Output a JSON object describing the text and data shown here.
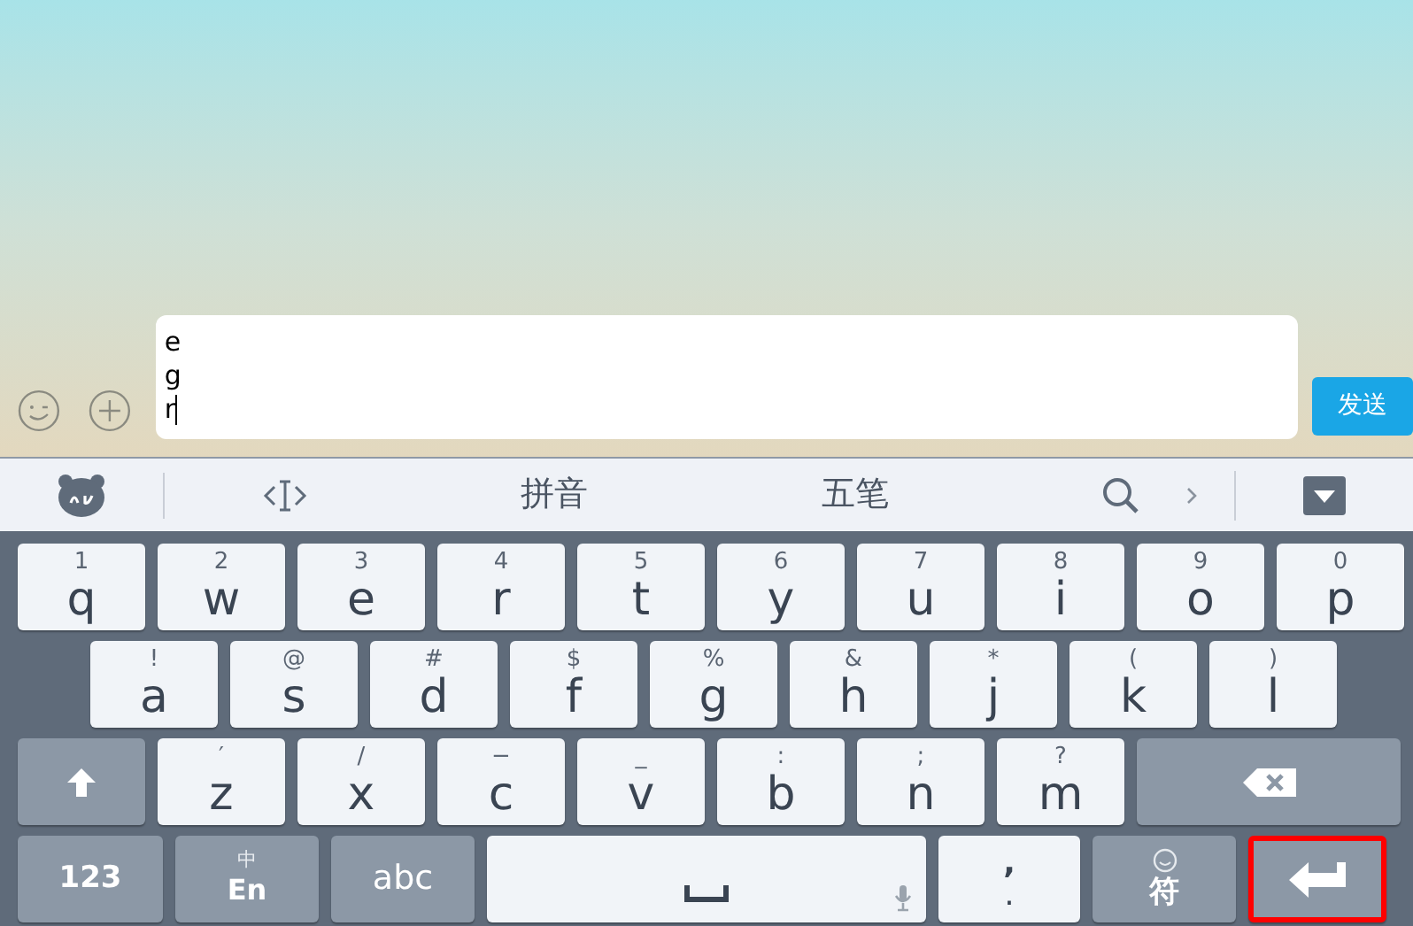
{
  "composer": {
    "lines": [
      "e",
      "g",
      "r"
    ],
    "send_button": "发送"
  },
  "toolbar": {
    "items": [
      {
        "kind": "logo"
      },
      {
        "kind": "cursor"
      },
      {
        "kind": "text",
        "label": "拼音"
      },
      {
        "kind": "text",
        "label": "五笔"
      },
      {
        "kind": "search"
      },
      {
        "kind": "more"
      },
      {
        "kind": "collapse"
      }
    ]
  },
  "keyboard": {
    "rows": [
      [
        {
          "kind": "char",
          "main": "q",
          "sub": "1"
        },
        {
          "kind": "char",
          "main": "w",
          "sub": "2"
        },
        {
          "kind": "char",
          "main": "e",
          "sub": "3"
        },
        {
          "kind": "char",
          "main": "r",
          "sub": "4"
        },
        {
          "kind": "char",
          "main": "t",
          "sub": "5"
        },
        {
          "kind": "char",
          "main": "y",
          "sub": "6"
        },
        {
          "kind": "char",
          "main": "u",
          "sub": "7"
        },
        {
          "kind": "char",
          "main": "i",
          "sub": "8"
        },
        {
          "kind": "char",
          "main": "o",
          "sub": "9"
        },
        {
          "kind": "char",
          "main": "p",
          "sub": "0"
        }
      ],
      [
        {
          "kind": "char",
          "main": "a",
          "sub": "!"
        },
        {
          "kind": "char",
          "main": "s",
          "sub": "@"
        },
        {
          "kind": "char",
          "main": "d",
          "sub": "#"
        },
        {
          "kind": "char",
          "main": "f",
          "sub": "$"
        },
        {
          "kind": "char",
          "main": "g",
          "sub": "%"
        },
        {
          "kind": "char",
          "main": "h",
          "sub": "&"
        },
        {
          "kind": "char",
          "main": "j",
          "sub": "*"
        },
        {
          "kind": "char",
          "main": "k",
          "sub": "("
        },
        {
          "kind": "char",
          "main": "l",
          "sub": ")"
        }
      ],
      [
        {
          "kind": "shift"
        },
        {
          "kind": "char",
          "main": "z",
          "sub": "′"
        },
        {
          "kind": "char",
          "main": "x",
          "sub": "/"
        },
        {
          "kind": "char",
          "main": "c",
          "sub": "−"
        },
        {
          "kind": "char",
          "main": "v",
          "sub": "_"
        },
        {
          "kind": "char",
          "main": "b",
          "sub": ":"
        },
        {
          "kind": "char",
          "main": "n",
          "sub": ";"
        },
        {
          "kind": "char",
          "main": "m",
          "sub": "?"
        },
        {
          "kind": "backspace"
        }
      ],
      [
        {
          "kind": "label",
          "main": "123"
        },
        {
          "kind": "lang",
          "main": "En",
          "sub": "中"
        },
        {
          "kind": "label",
          "main": "abc"
        },
        {
          "kind": "space"
        },
        {
          "kind": "punct",
          "main": ".",
          "sub": ","
        },
        {
          "kind": "symbol",
          "main": "符"
        },
        {
          "kind": "enter",
          "highlighted": true
        }
      ]
    ]
  }
}
